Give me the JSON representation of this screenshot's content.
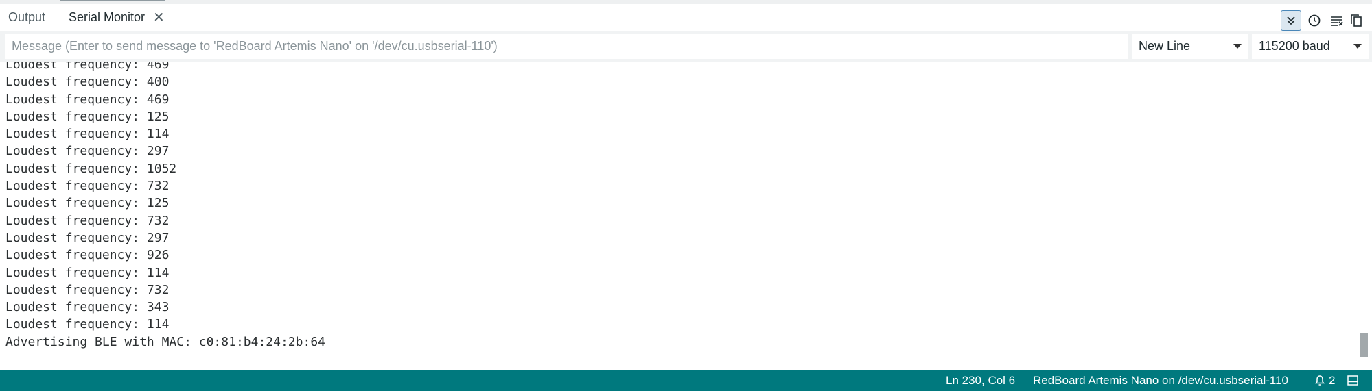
{
  "tabs": {
    "output_label": "Output",
    "serial_monitor_label": "Serial Monitor",
    "close_glyph": "✕"
  },
  "toolbar": {
    "icons": [
      "autoscroll-icon",
      "timestamp-icon",
      "clear-output-icon",
      "copy-icon"
    ]
  },
  "message": {
    "placeholder": "Message (Enter to send message to 'RedBoard Artemis Nano' on '/dev/cu.usbserial-110')",
    "value": ""
  },
  "line_ending": {
    "selected": "New Line"
  },
  "baud_rate": {
    "selected": "115200 baud"
  },
  "output": {
    "lines": [
      "Loudest frequency: 469",
      "Loudest frequency: 400",
      "Loudest frequency: 469",
      "Loudest frequency: 125",
      "Loudest frequency: 114",
      "Loudest frequency: 297",
      "Loudest frequency: 1052",
      "Loudest frequency: 732",
      "Loudest frequency: 125",
      "Loudest frequency: 732",
      "Loudest frequency: 297",
      "Loudest frequency: 926",
      "Loudest frequency: 114",
      "Loudest frequency: 732",
      "Loudest frequency: 343",
      "Loudest frequency: 114",
      "Advertising BLE with MAC: c0:81:b4:24:2b:64"
    ]
  },
  "statusbar": {
    "cursor_position": "Ln 230, Col 6",
    "board": "RedBoard Artemis Nano on /dev/cu.usbserial-110",
    "notifications_count": "2"
  },
  "colors": {
    "statusbar_bg": "#00797e",
    "autoscroll_active_bg": "#dbe7f0",
    "autoscroll_active_border": "#4a87b8"
  }
}
